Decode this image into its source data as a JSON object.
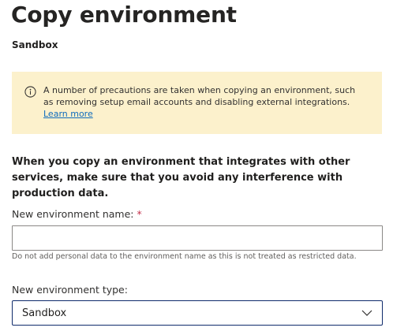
{
  "page": {
    "title": "Copy environment",
    "subtitle": "Sandbox"
  },
  "info": {
    "icon": "info-icon",
    "text": "A number of precautions are taken when copying an environment, such as removing setup email accounts and disabling external integrations.",
    "link_text": "Learn more"
  },
  "lead_text": "When you copy an environment that integrates with other services, make sure that you avoid any interference with production data.",
  "name_field": {
    "label": "New environment name:",
    "required_marker": "*",
    "value": "",
    "helper": "Do not add personal data to the environment name as this is not treated as restricted data."
  },
  "type_field": {
    "label": "New environment type:",
    "selected": "Sandbox",
    "icon": "chevron-down-icon"
  },
  "colors": {
    "banner_bg": "#fcf1cc",
    "link": "#0f6cbd",
    "required": "#c4314b",
    "select_border": "#0f2b6b"
  }
}
